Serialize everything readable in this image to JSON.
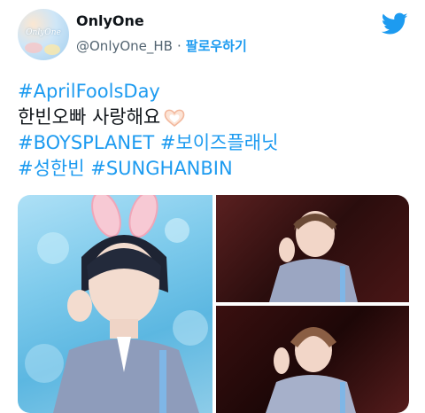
{
  "header": {
    "display_name": "OnlyOne",
    "handle": "@OnlyOne_HB",
    "separator": "·",
    "follow_label": "팔로우하기",
    "avatar_text": "OnlyOne"
  },
  "tweet": {
    "line1_tag": "#AprilFoolsDay",
    "line2_text": "한빈오빠 사랑해요",
    "line3_tag1": "#BOYSPLANET",
    "line3_tag2": "#보이즈플래닛",
    "line4_tag1": "#성한빈",
    "line4_tag2": "#SUNGHANBIN"
  },
  "colors": {
    "link": "#1d9bf0",
    "text": "#0f1419",
    "secondary": "#536471"
  },
  "icons": {
    "brand": "twitter-bird-icon",
    "emoji": "heart-hands-icon"
  }
}
